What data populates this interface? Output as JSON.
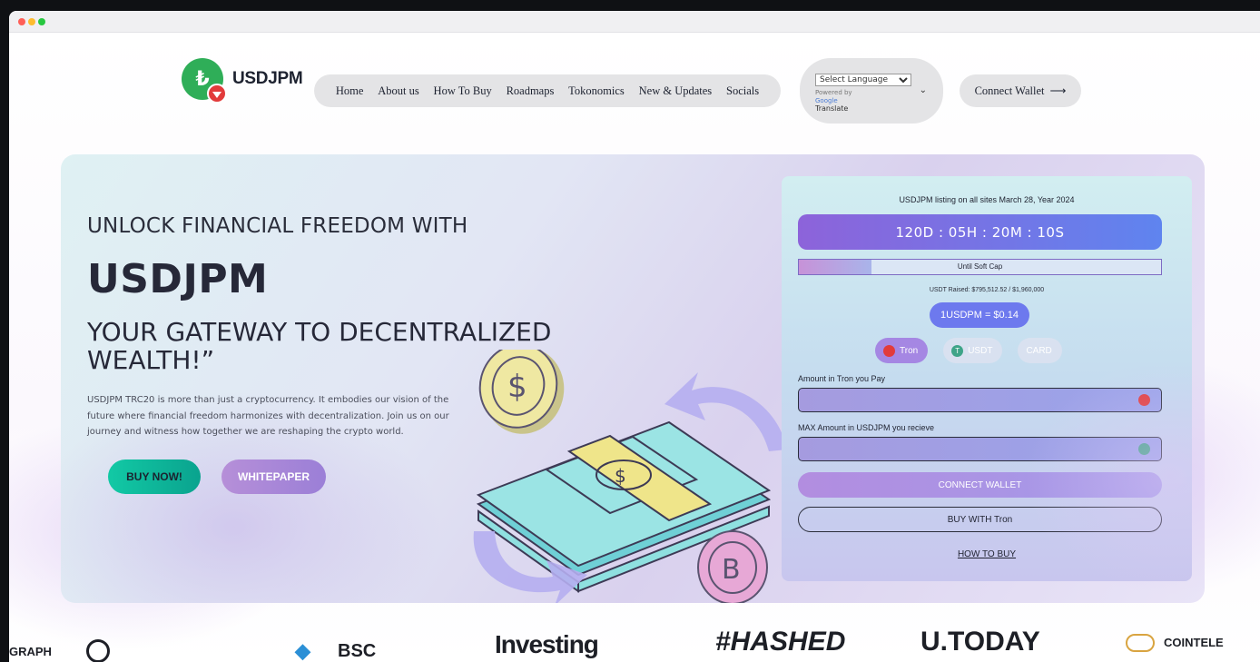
{
  "browser": {
    "traffic_lights": [
      "close",
      "minimize",
      "maximize"
    ]
  },
  "brand": {
    "name": "USDJPM",
    "mark_glyph": "₺"
  },
  "nav": {
    "items": [
      "Home",
      "About us",
      "How To Buy",
      "Roadmaps",
      "Tokonomics",
      "New & Updates",
      "Socials"
    ]
  },
  "language": {
    "select_label": "Select Language",
    "powered_by": "Powered by",
    "google": "Google",
    "translate": "Translate",
    "chevron": "⌄"
  },
  "header": {
    "connect_wallet": "Connect Wallet",
    "arrow": "⟶"
  },
  "hero": {
    "kicker": "UNLOCK FINANCIAL FREEDOM WITH",
    "title": "USDJPM",
    "subtitle": "YOUR GATEWAY TO DECENTRALIZED WEALTH!”",
    "description": "USDJPM TRC20 is more than just a cryptocurrency. It embodies our vision of the future where financial freedom harmonizes with decentralization. Join us on our journey and witness how together we are reshaping the crypto world.",
    "buy_now": "BUY NOW!",
    "whitepaper": "WHITEPAPER"
  },
  "presale": {
    "listing": "USDJPM listing on all sites March 28, Year 2024",
    "countdown": "120D : 05H : 20M : 10S",
    "progress_label": "Until Soft Cap",
    "progress_fraction": 0.2,
    "raised": "USDT Raised: $795,512.52 / $1,960,000",
    "price": "1USDPM = $0.14",
    "tabs": [
      {
        "label": "Tron",
        "active": true
      },
      {
        "label": "USDT",
        "active": false
      },
      {
        "label": "CARD",
        "active": false
      }
    ],
    "pay_label": "Amount in Tron you Pay",
    "receive_label": "MAX Amount in USDJPM you recieve",
    "connect_wallet": "CONNECT WALLET",
    "buy_with": "BUY WITH Tron",
    "how_to_buy": "HOW TO BUY"
  },
  "partners": [
    "GRAPH",
    "",
    "BSC",
    "Investing",
    "#HASHED",
    "U.TODAY",
    "COINTELE"
  ],
  "colors": {
    "accent_purple": "#8d63da",
    "accent_blue": "#5f84ef",
    "buy_green": "#12c9a5",
    "tron_red": "#e23b3b",
    "usdt_green": "#3fa488"
  }
}
